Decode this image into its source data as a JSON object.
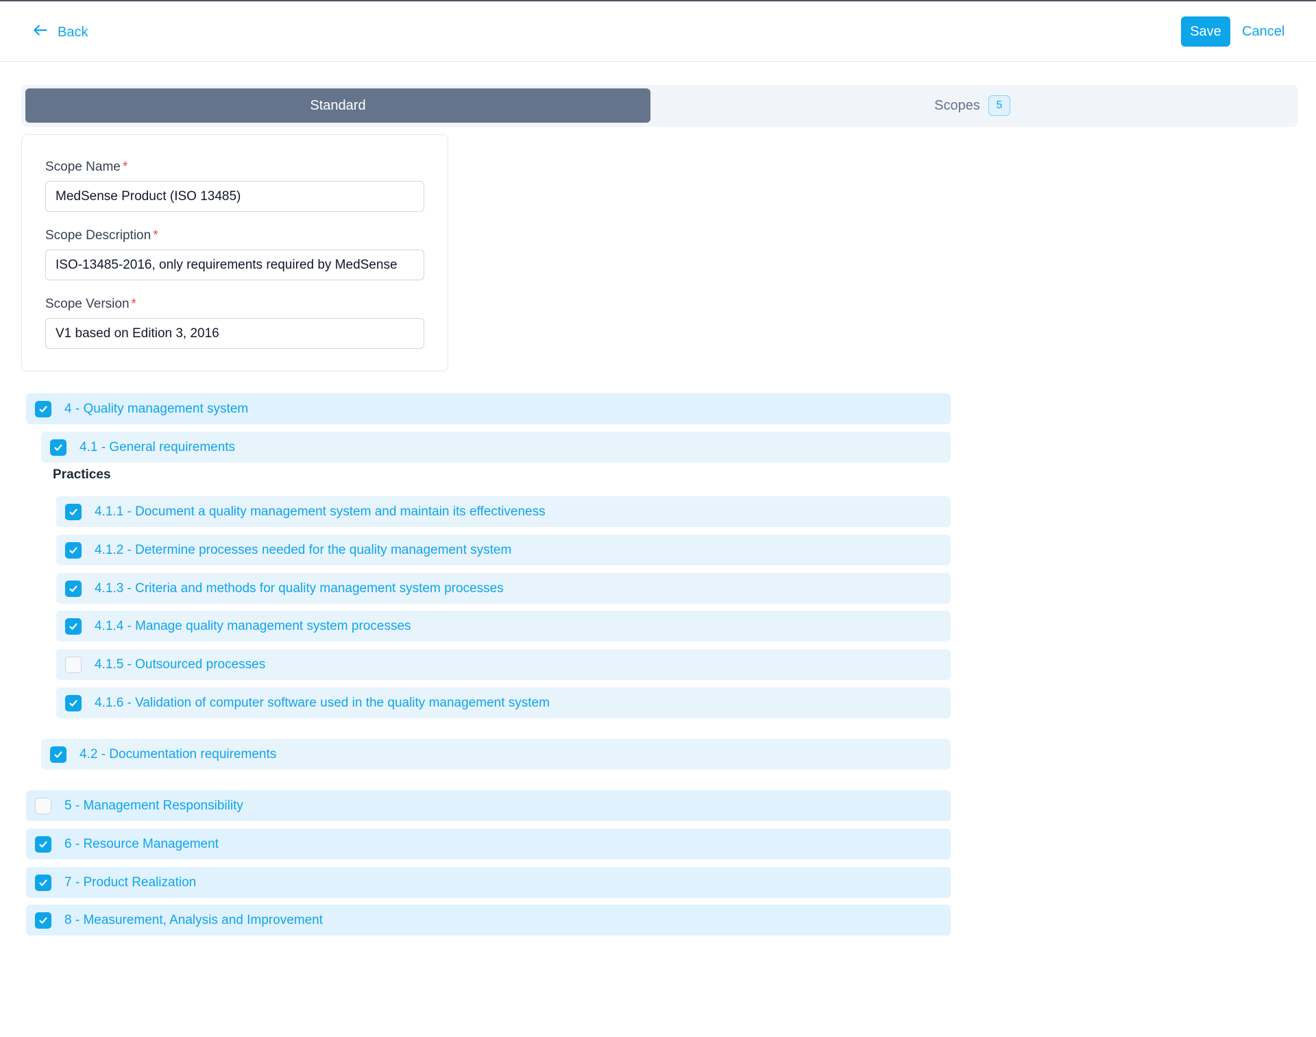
{
  "header": {
    "back_label": "Back",
    "save_label": "Save",
    "cancel_label": "Cancel"
  },
  "tabs": {
    "standard_label": "Standard",
    "scopes_label": "Scopes",
    "scopes_count": "5",
    "active": "Standard"
  },
  "form": {
    "scope_name": {
      "label": "Scope Name",
      "required_mark": "*",
      "value": "MedSense Product (ISO 13485)"
    },
    "scope_description": {
      "label": "Scope Description",
      "required_mark": "*",
      "value": "ISO-13485-2016, only requirements required by MedSense"
    },
    "scope_version": {
      "label": "Scope Version",
      "required_mark": "*",
      "value": "V1 based on Edition 3, 2016"
    }
  },
  "practices_label": "Practices",
  "tree": {
    "s4": {
      "label": "4 - Quality management system",
      "checked": true
    },
    "s4_1": {
      "label": "4.1 - General requirements",
      "checked": true
    },
    "p4_1_1": {
      "label": "4.1.1 - Document a quality management system and maintain its effectiveness",
      "checked": true
    },
    "p4_1_2": {
      "label": "4.1.2 - Determine processes needed for the quality management system",
      "checked": true
    },
    "p4_1_3": {
      "label": "4.1.3 - Criteria and methods for quality management system processes",
      "checked": true
    },
    "p4_1_4": {
      "label": "4.1.4 - Manage quality management system processes",
      "checked": true
    },
    "p4_1_5": {
      "label": "4.1.5 - Outsourced processes",
      "checked": false
    },
    "p4_1_6": {
      "label": "4.1.6 - Validation of computer software used in the quality management system",
      "checked": true
    },
    "s4_2": {
      "label": "4.2 - Documentation requirements",
      "checked": true
    },
    "s5": {
      "label": "5 - Management Responsibility",
      "checked": false
    },
    "s6": {
      "label": "6 - Resource Management",
      "checked": true
    },
    "s7": {
      "label": "7 - Product Realization",
      "checked": true
    },
    "s8": {
      "label": "8 - Measurement, Analysis and Improvement",
      "checked": true
    }
  },
  "colors": {
    "accent": "#0ea5e9",
    "active_tab": "#64748b",
    "row_bg": "#e0f2fe",
    "required": "#ef4444"
  },
  "icons": {
    "back": "arrow-left-icon",
    "checkbox_checked": "check-icon"
  }
}
